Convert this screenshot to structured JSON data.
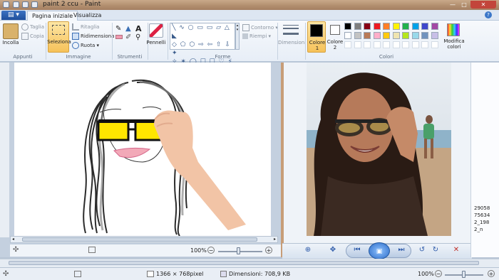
{
  "window": {
    "title": "paint 2 ccu - Paint"
  },
  "tabs": {
    "file": "▤ ▾",
    "home": "Pagina iniziale",
    "view": "Visualizza"
  },
  "ribbon": {
    "clipboard": {
      "paste": "Incolla",
      "cut": "Taglia",
      "copy": "Copia",
      "label": "Appunti"
    },
    "image": {
      "select": "Seleziona",
      "crop": "Ritaglia",
      "resize": "Ridimensiona",
      "rotate": "Ruota",
      "label": "Immagine"
    },
    "tools": {
      "label": "Strumenti"
    },
    "brushes": {
      "label": "Pennelli"
    },
    "shapes": {
      "outline": "Contorno",
      "fill": "Riempi",
      "label": "Forme"
    },
    "size": {
      "label": "Dimensioni"
    },
    "colors": {
      "color1": "Colore 1",
      "color2": "Colore 2",
      "edit": "Modifica colori",
      "label": "Colori",
      "color1_value": "#000000",
      "color2_value": "#ffffff",
      "palette_row1": [
        "#000000",
        "#7f7f7f",
        "#880015",
        "#ed1c24",
        "#ff7f27",
        "#fff200",
        "#22b14c",
        "#00a2e8",
        "#3f48cc",
        "#a349a4"
      ],
      "palette_row2": [
        "#ffffff",
        "#c3c3c3",
        "#b97a57",
        "#ffaec9",
        "#ffc90e",
        "#efe4b0",
        "#b5e61d",
        "#99d9ea",
        "#7092be",
        "#c8bfe7"
      ]
    }
  },
  "inner_status": {
    "zoom": "100%"
  },
  "right_strip": {
    "lines": [
      "29058",
      "75634",
      "2_198",
      "2_n"
    ]
  },
  "status": {
    "dimensions": "1366 × 768pixel",
    "filesize": "Dimensioni: 708,9 KB",
    "zoom": "100%"
  }
}
